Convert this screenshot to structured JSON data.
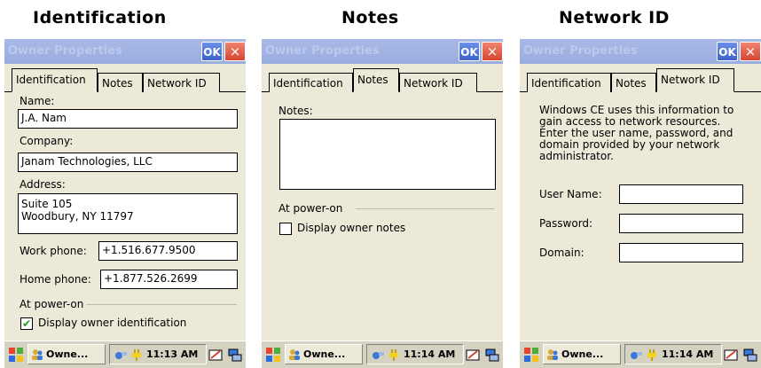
{
  "headings": [
    "Identification",
    "Notes",
    "Network ID"
  ],
  "window_title": "Owner Properties",
  "ok_label": "OK",
  "close_glyph": "×",
  "tabs": [
    "Identification",
    "Notes",
    "Network ID"
  ],
  "identification": {
    "name_label": "Name:",
    "name_value": "J.A. Nam",
    "company_label": "Company:",
    "company_value": "Janam Technologies, LLC",
    "address_label": "Address:",
    "address_value": "Suite 105\nWoodbury, NY 11797",
    "work_phone_label": "Work phone:",
    "work_phone_value": "+1.516.677.9500",
    "home_phone_label": "Home phone:",
    "home_phone_value": "+1.877.526.2699",
    "power_on_label": "At power-on",
    "display_label": "Display owner identification",
    "display_checked": true,
    "check_glyph": "✔"
  },
  "notes": {
    "notes_label": "Notes:",
    "notes_value": "",
    "power_on_label": "At power-on",
    "display_label": "Display owner notes",
    "display_checked": false
  },
  "network": {
    "description": "Windows CE uses this information to gain access to network resources. Enter the user name, password, and domain provided by your network administrator.",
    "user_label": "User Name:",
    "password_label": "Password:",
    "domain_label": "Domain:",
    "user_value": "",
    "password_value": "",
    "domain_value": ""
  },
  "taskbar": {
    "task_label": "Owne...",
    "clocks": [
      "11:13 AM",
      "11:14 AM",
      "11:14 AM"
    ]
  },
  "colors": {
    "window_bg": "#ece9d8",
    "title_bar": "#98addf",
    "ok_button": "#3d63cc",
    "close_button": "#d6452f",
    "check_mark": "#1a9a1a"
  }
}
